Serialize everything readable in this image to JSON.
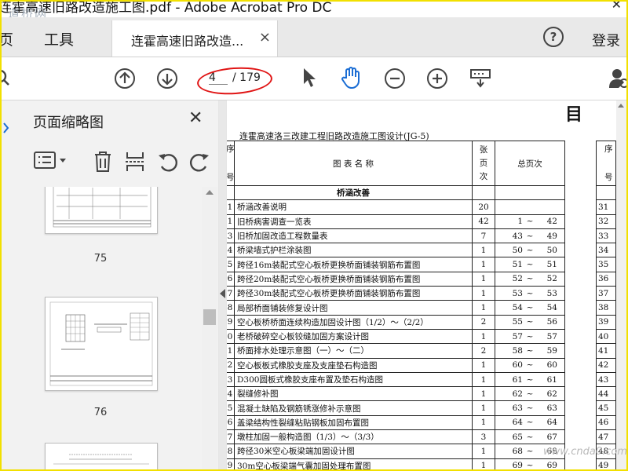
{
  "window": {
    "title": "连霍高速旧路改造施工图.pdf - Adobe Acrobat Pro DC",
    "watermark": "道桥网",
    "close_glyph": "✕"
  },
  "tabs": {
    "home": "页",
    "tools": "工具",
    "doc": "连霍高速旧路改造...",
    "close_glyph": "×",
    "help": "?",
    "login": "登录"
  },
  "toolbar": {
    "current_page": "4",
    "total_pages": "/ 179"
  },
  "panel": {
    "title": "页面缩略图",
    "close_glyph": "✕",
    "thumbs": [
      "75",
      "76"
    ]
  },
  "document": {
    "heading": "目",
    "subtitle": "连霍高速洛三改建工程旧路改造施工图设计(JG-5)",
    "header": {
      "no_top": "序",
      "no_bottom": "号",
      "name": "图  表  名  称",
      "count": "张\n页\n次",
      "range": "总页次"
    },
    "section": "桥涵改善",
    "tilde": "~",
    "rows": [
      {
        "no": "1",
        "name": "桥涵改善说明",
        "count": "20",
        "from": "",
        "to": ""
      },
      {
        "no": "1",
        "name": "旧桥病害调查一览表",
        "count": "42",
        "from": "1",
        "to": "42"
      },
      {
        "no": "3",
        "name": "旧桥加固改造工程数量表",
        "count": "7",
        "from": "43",
        "to": "49"
      },
      {
        "no": "4",
        "name": "桥梁墙式护栏涂装图",
        "count": "1",
        "from": "50",
        "to": "50"
      },
      {
        "no": "5",
        "name": "跨径16m装配式空心板桥更换桥面铺装钢筋布置图",
        "count": "1",
        "from": "51",
        "to": "51"
      },
      {
        "no": "6",
        "name": "跨径20m装配式空心板桥更换桥面铺装钢筋布置图",
        "count": "1",
        "from": "52",
        "to": "52"
      },
      {
        "no": "7",
        "name": "跨径30m装配式空心板桥更换桥面铺装钢筋布置图",
        "count": "1",
        "from": "53",
        "to": "53"
      },
      {
        "no": "8",
        "name": "局部桥面铺装修复设计图",
        "count": "1",
        "from": "54",
        "to": "54"
      },
      {
        "no": "9",
        "name": "空心板桥桥面连续构造加固设计图（1/2）～（2/2）",
        "count": "2",
        "from": "55",
        "to": "56"
      },
      {
        "no": "0",
        "name": "老桥破碎空心板铰缝加固方案设计图",
        "count": "1",
        "from": "57",
        "to": "57"
      },
      {
        "no": "1",
        "name": "桥面排水处理示意图（一）～（二）",
        "count": "2",
        "from": "58",
        "to": "59"
      },
      {
        "no": "2",
        "name": "空心板板式橡胶支座及支座垫石构造图",
        "count": "1",
        "from": "60",
        "to": "60"
      },
      {
        "no": "3",
        "name": "D300圆板式橡胶支座布置及垫石构造图",
        "count": "1",
        "from": "61",
        "to": "61"
      },
      {
        "no": "4",
        "name": "裂缝修补图",
        "count": "1",
        "from": "62",
        "to": "62"
      },
      {
        "no": "5",
        "name": "混凝土缺陷及钢筋锈涨修补示意图",
        "count": "1",
        "from": "63",
        "to": "63"
      },
      {
        "no": "6",
        "name": "盖梁结构性裂缝粘贴钢板加固布置图",
        "count": "1",
        "from": "64",
        "to": "64"
      },
      {
        "no": "7",
        "name": "墩柱加固一般构造图（1/3）～（3/3）",
        "count": "3",
        "from": "65",
        "to": "67"
      },
      {
        "no": "8",
        "name": "跨径30米空心板梁端加固设计图",
        "count": "1",
        "from": "68",
        "to": "68"
      },
      {
        "no": "9",
        "name": "30m空心板梁端气囊加固处理布置图",
        "count": "1",
        "from": "69",
        "to": "69"
      }
    ],
    "right_header": {
      "top": "序",
      "bottom": "号"
    },
    "right_numbers": [
      "31",
      "32",
      "33",
      "34",
      "35",
      "36",
      "37",
      "38",
      "39",
      "40",
      "41",
      "42",
      "43",
      "44",
      "45",
      "46",
      "47",
      "48",
      "49"
    ]
  },
  "site_watermark": "www.cnda0.com"
}
